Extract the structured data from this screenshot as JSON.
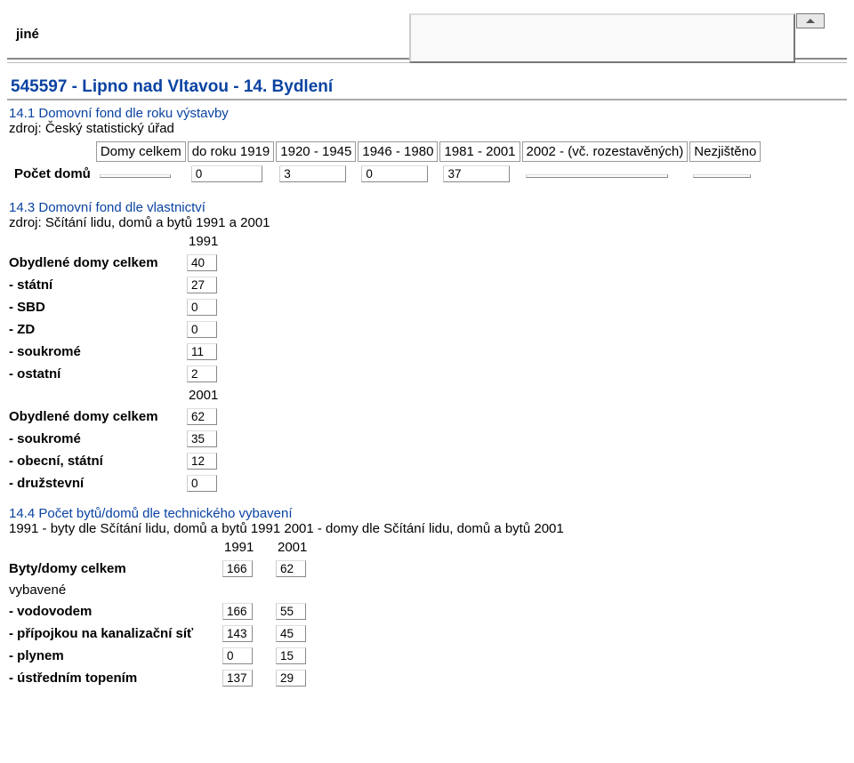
{
  "header": {
    "other_label": "jiné",
    "title": "545597 - Lipno nad Vltavou - 14. Bydlení"
  },
  "section_14_1": {
    "heading": "14.1 Domovní fond dle roku výstavby",
    "source": "zdroj: Český statistický úřad",
    "cols": {
      "c0": "",
      "c1": "Domy celkem",
      "c2": "do roku 1919",
      "c3": "1920 - 1945",
      "c4": "1946 - 1980",
      "c5": "1981 - 2001",
      "c6": "2002 - (vč. rozestavěných)",
      "c7": "Nezjištěno"
    },
    "row": {
      "label": "Počet domů",
      "v1": "",
      "v2": "0",
      "v3": "3",
      "v4": "0",
      "v5": "37",
      "v6": "",
      "v7": ""
    }
  },
  "section_14_3": {
    "heading": "14.3 Domovní fond dle vlastnictví",
    "source": "zdroj: Sčítání lidu, domů a bytů 1991 a 2001",
    "year_1991": "1991",
    "year_2001": "2001",
    "rows_1991": {
      "total_lbl": "Obydlené domy celkem",
      "total_v": "40",
      "statni_lbl": "- státní",
      "statni_v": "27",
      "sbd_lbl": "- SBD",
      "sbd_v": "0",
      "zd_lbl": "- ZD",
      "zd_v": "0",
      "soukrome_lbl": "- soukromé",
      "soukrome_v": "11",
      "ostatni_lbl": "- ostatní",
      "ostatni_v": "2"
    },
    "rows_2001": {
      "total_lbl": "Obydlené domy celkem",
      "total_v": "62",
      "soukrome_lbl": "- soukromé",
      "soukrome_v": "35",
      "obecni_lbl": "- obecní, státní",
      "obecni_v": "12",
      "druz_lbl": "- družstevní",
      "druz_v": "0"
    }
  },
  "section_14_4": {
    "heading": "14.4 Počet bytů/domů dle technického vybavení",
    "source": "1991 - byty dle Sčítání lidu, domů a bytů 1991 2001 - domy dle Sčítání lidu, domů a bytů 2001",
    "year_1991": "1991",
    "year_2001": "2001",
    "rows": {
      "total_lbl": "Byty/domy celkem",
      "total_1991": "166",
      "total_2001": "62",
      "vyb_lbl": "vybavené",
      "vod_lbl": "- vodovodem",
      "vod_1991": "166",
      "vod_2001": "55",
      "kan_lbl": "- přípojkou na kanalizační síť",
      "kan_1991": "143",
      "kan_2001": "45",
      "plyn_lbl": "- plynem",
      "plyn_1991": "0",
      "plyn_2001": "15",
      "top_lbl": "- ústředním topením",
      "top_1991": "137",
      "top_2001": "29"
    }
  }
}
